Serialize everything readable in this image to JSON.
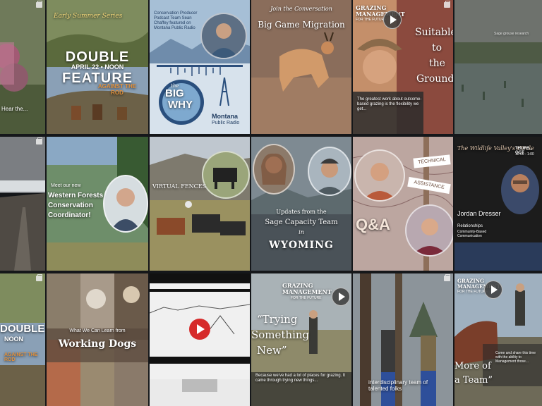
{
  "grid": {
    "tiles": [
      {
        "id": "r1c1",
        "caption1": "",
        "caption2": "Hear the..."
      },
      {
        "id": "r1c2",
        "kicker": "Early Summer Series",
        "title1": "DOUBLE",
        "date": "APRIL 22 • NOON",
        "title2": "FEATURE",
        "sub": "AGAINST THE ROD"
      },
      {
        "id": "r1c3",
        "intro": "Conservation Producer Podcast Team Sean Chaffey featured on Montana Public Radio",
        "logo_small": "the",
        "logo_big": "BIG",
        "logo_big2": "WHY",
        "station": "Montana",
        "station2": "Public Radio"
      },
      {
        "id": "r1c4",
        "kicker": "Join the Conversation",
        "title": "Big Game Migration"
      },
      {
        "id": "r1c5",
        "badge1": "GRAZING",
        "badge2": "MANAGEMENT",
        "badge3": "FOR THE FUTURE",
        "quote1": "Suitable",
        "quote2": "to",
        "quote3": "the",
        "quote4": "Ground",
        "body": "The greatest work about outcome-based grazing is the flexibility we get..."
      },
      {
        "id": "r1c6",
        "caption": "Sage grouse research"
      },
      {
        "id": "r2c1",
        "caption": ""
      },
      {
        "id": "r2c2",
        "line1": "Meet our new",
        "line2": "Western Forests",
        "line3": "Conservation",
        "line4": "Coordinator!"
      },
      {
        "id": "r2c3",
        "caption": "VIRTUAL FENCES"
      },
      {
        "id": "r2c4",
        "line1": "Updates from the",
        "line2": "Sage Capacity Team",
        "line3": "in",
        "line4": "WYOMING"
      },
      {
        "id": "r2c5",
        "sign1": "TECHNICAL",
        "sign2": "ASSISTANCE",
        "qa": "Q&A"
      },
      {
        "id": "r2c6",
        "title": "The Wildlife Valley's Circle",
        "event": "THURS., OCT",
        "time": "12:00 - 1:00",
        "name": "Jordan Dresser",
        "sub": "Relationships",
        "sub2": "Community-Based Communication"
      },
      {
        "id": "r3c1",
        "title1": "DOUBLE",
        "date": "NOON",
        "sub": "AGAINST THE ROD"
      },
      {
        "id": "r3c2",
        "line1": "What We Can Learn from",
        "line2": "Working Dogs"
      },
      {
        "id": "r3c3",
        "caption": ""
      },
      {
        "id": "r3c4",
        "badge1": "GRAZING",
        "badge2": "MANAGEMENT",
        "badge3": "FOR THE FUTURE",
        "q1": "“Trying",
        "q2": "Something",
        "q3": "New”",
        "body": "Because we've had a lot of places for grazing. It came through trying new things..."
      },
      {
        "id": "r3c5",
        "caption": "interdisciplinary team of talented folks"
      },
      {
        "id": "r3c6",
        "badge1": "GRAZING",
        "badge2": "MANAGEMENT",
        "badge3": "FOR THE FUTURE",
        "q1": "More of",
        "q2": "a Team”",
        "body": "Come and share this time with the ability to Management those..."
      }
    ]
  }
}
